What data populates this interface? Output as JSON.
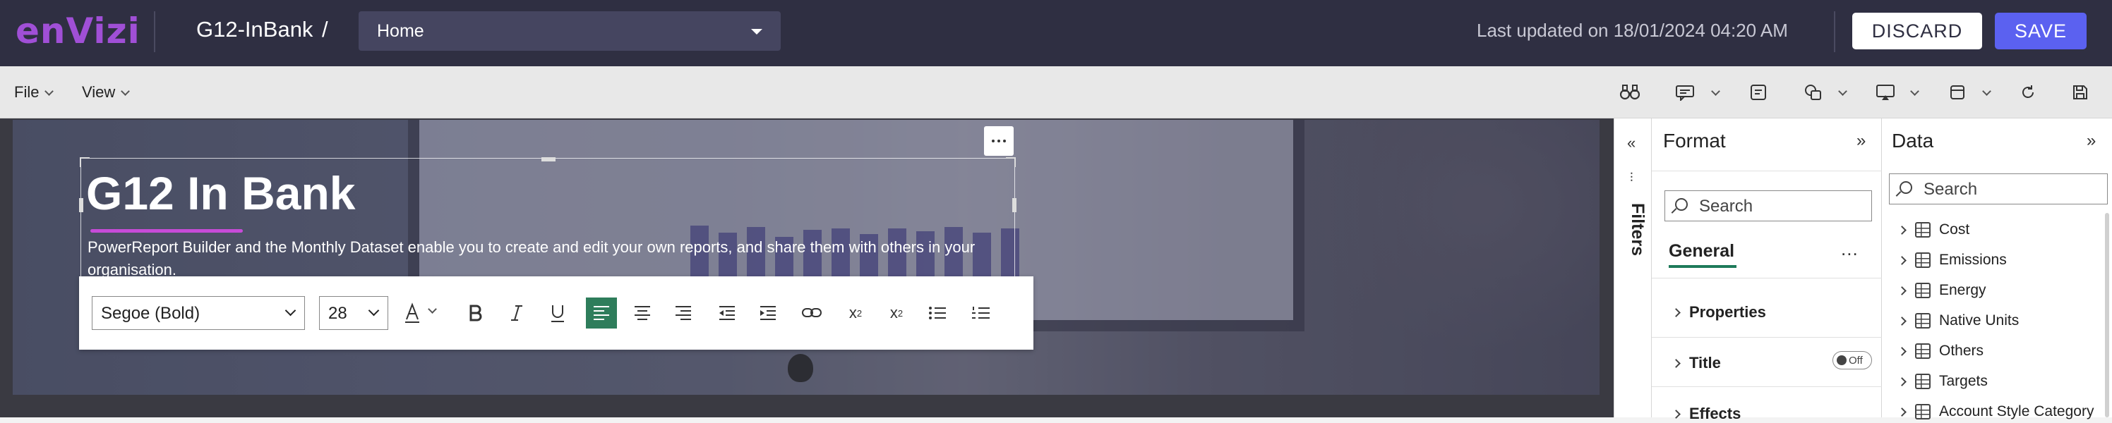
{
  "header": {
    "logo_text": "enVizi",
    "report_name": "G12-InBank",
    "separator": "/",
    "page_select": "Home",
    "last_updated": "Last updated on 18/01/2024 04:20 AM",
    "discard_label": "DISCARD",
    "save_label": "SAVE",
    "colors": {
      "bar_bg": "#2f2f42",
      "logo": "#a04fd6",
      "save": "#5b61f0"
    }
  },
  "menubar": {
    "file_label": "File",
    "view_label": "View",
    "tool_icons": [
      "binoculars-icon",
      "comment-icon",
      "notes-icon",
      "shapes-icon",
      "visual-icon",
      "page-icon",
      "refresh-icon",
      "save-icon"
    ]
  },
  "canvas": {
    "title": "G12 In Bank",
    "subtitle": "PowerReport Builder and the Monthly Dataset enable you to create and edit your own reports, and share them with others in your organisation.",
    "more_label": "...",
    "format_bar": {
      "font": "Segoe (Bold)",
      "size": "28",
      "buttons": [
        "font-color",
        "bold",
        "italic",
        "underline",
        "align-left",
        "align-center",
        "align-right",
        "decrease-indent",
        "increase-indent",
        "link",
        "superscript",
        "subscript",
        "bullet-list",
        "numbered-list"
      ],
      "active_button": "align-left",
      "active_color": "#2e7d5b"
    }
  },
  "filters": {
    "label": "Filters"
  },
  "format_pane": {
    "title": "Format",
    "search_placeholder": "Search",
    "general_label": "General",
    "general_more": "...",
    "sections": [
      "Properties",
      "Title",
      "Effects"
    ],
    "title_toggle": "Off"
  },
  "data_pane": {
    "title": "Data",
    "search_placeholder": "Search",
    "items": [
      "Cost",
      "Emissions",
      "Energy",
      "Native Units",
      "Others",
      "Targets",
      "Account Style Category"
    ]
  }
}
